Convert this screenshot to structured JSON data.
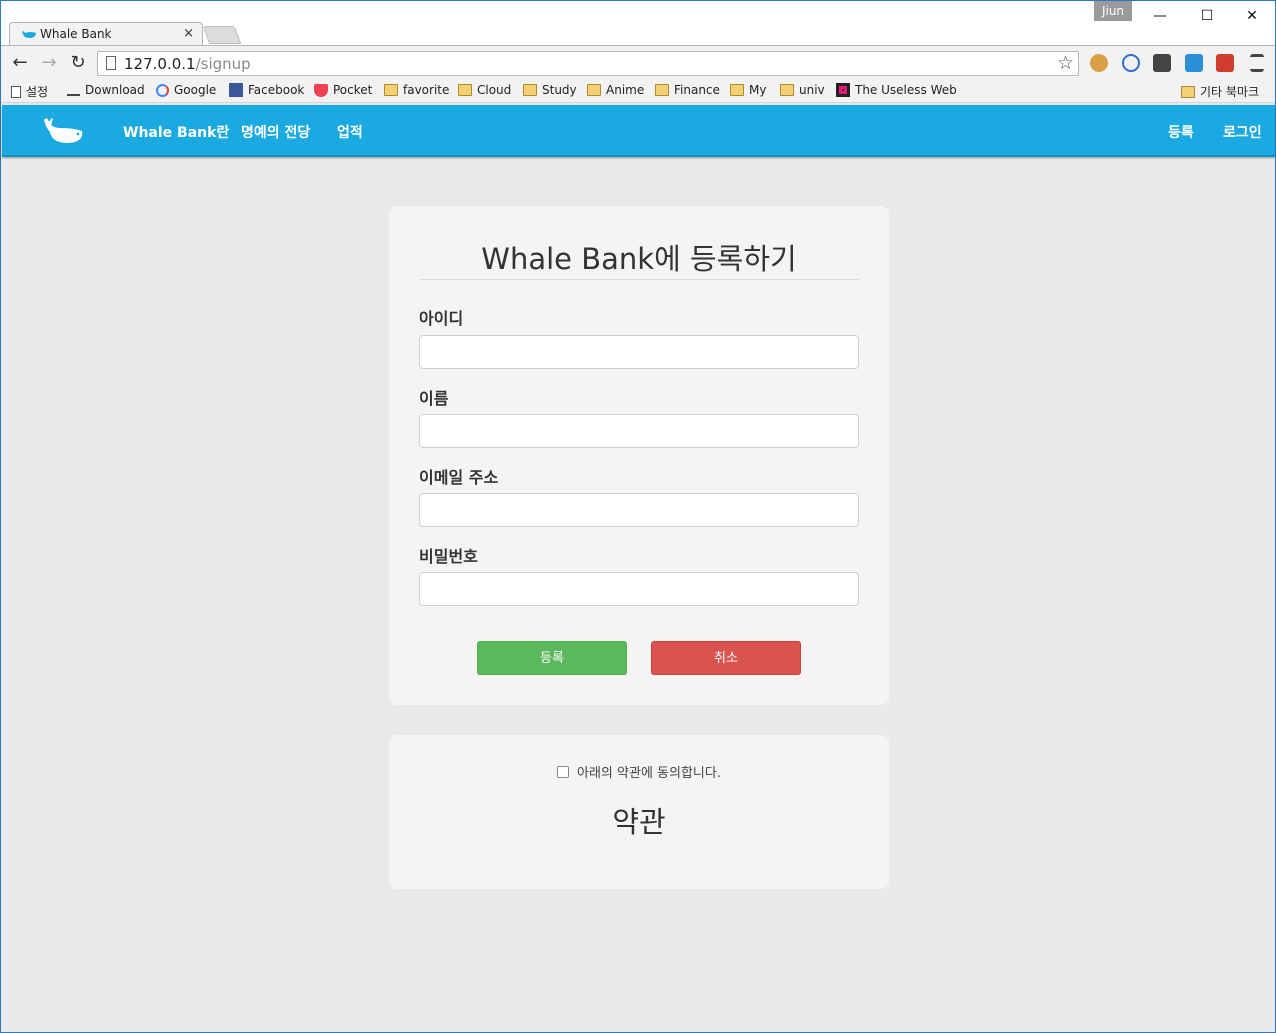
{
  "browser": {
    "tab_title": "Whale Bank",
    "tab_close": "×",
    "profile_name": "Jiun",
    "window_buttons": {
      "minimize": "—",
      "maximize": "☐",
      "close": "✕"
    },
    "nav": {
      "back": "←",
      "forward": "→",
      "reload": "↻"
    },
    "url_host": "127.0.0.1",
    "url_path": "/signup",
    "star": "☆",
    "bookmarks": [
      {
        "label": "설정",
        "icon": "page-icon"
      },
      {
        "label": "Download",
        "icon": "download-icon"
      },
      {
        "label": "Google",
        "icon": "google-icon"
      },
      {
        "label": "Facebook",
        "icon": "facebook-icon"
      },
      {
        "label": "Pocket",
        "icon": "pocket-icon"
      },
      {
        "label": "favorite",
        "icon": "folder-icon"
      },
      {
        "label": "Cloud",
        "icon": "folder-icon"
      },
      {
        "label": "Study",
        "icon": "folder-icon"
      },
      {
        "label": "Anime",
        "icon": "folder-icon"
      },
      {
        "label": "Finance",
        "icon": "folder-icon"
      },
      {
        "label": "My",
        "icon": "folder-icon"
      },
      {
        "label": "univ",
        "icon": "folder-icon"
      },
      {
        "label": "The Useless Web",
        "icon": "useless-web-icon"
      }
    ],
    "other_bookmarks": "기타 북마크"
  },
  "site": {
    "brand_color": "#1ba9e1",
    "nav_left": [
      "Whale Bank란",
      "명예의 전당",
      "업적"
    ],
    "nav_right": [
      "등록",
      "로그인"
    ]
  },
  "signup": {
    "title": "Whale Bank에 등록하기",
    "fields": [
      {
        "label": "아이디",
        "value": ""
      },
      {
        "label": "이름",
        "value": ""
      },
      {
        "label": "이메일 주소",
        "value": ""
      },
      {
        "label": "비밀번호",
        "value": ""
      }
    ],
    "submit_label": "등록",
    "cancel_label": "취소"
  },
  "terms": {
    "agree_label": "아래의 약관에 동의합니다.",
    "agree_checked": false,
    "title": "약관"
  }
}
